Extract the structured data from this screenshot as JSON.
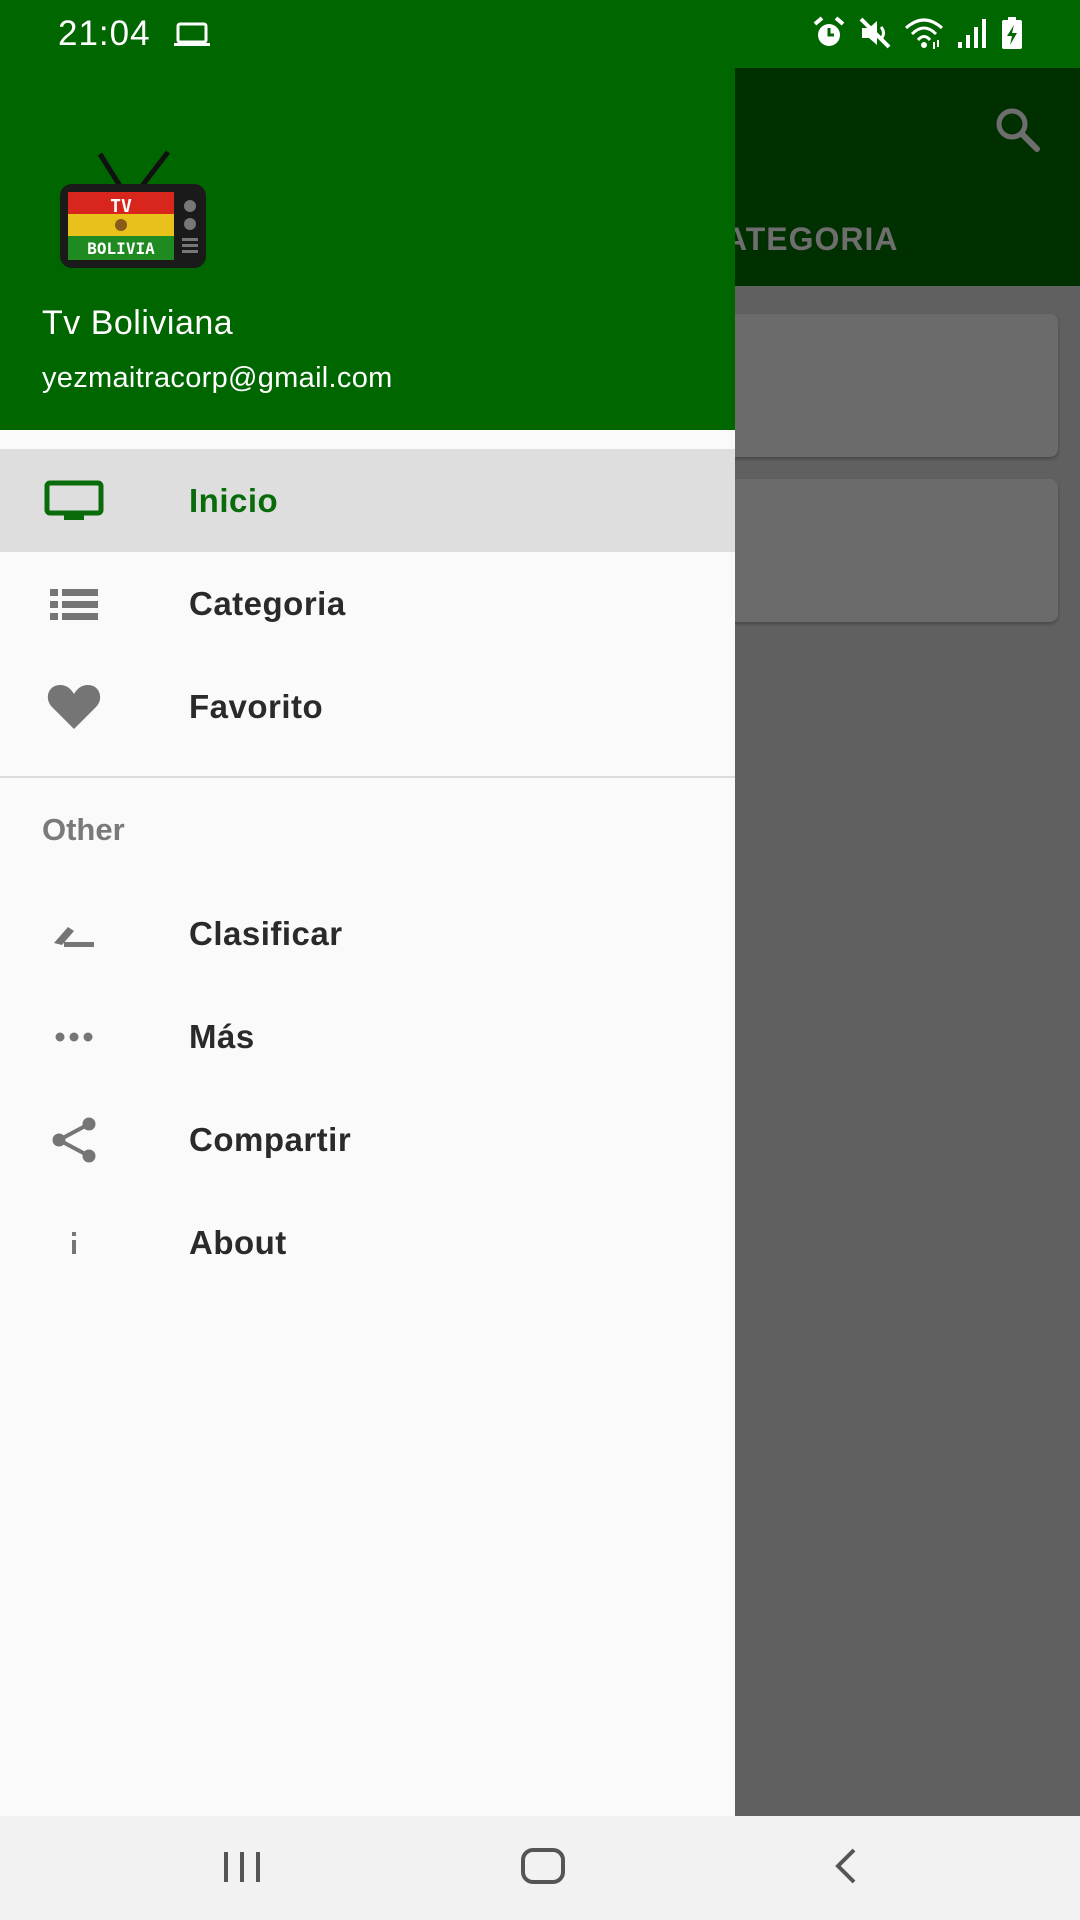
{
  "status_bar": {
    "time": "21:04",
    "left_icons": [
      "laptop-icon"
    ],
    "right_icons": [
      "alarm-icon",
      "mute-icon",
      "wifi-icon",
      "signal-icon",
      "battery-charging-icon"
    ]
  },
  "app": {
    "search_icon": "search-icon",
    "tab_label": "ATEGORIA"
  },
  "drawer": {
    "header": {
      "title": "Tv Boliviana",
      "email": "yezmaitracorp@gmail.com",
      "logo_text": [
        "TV",
        "BOLIVIA"
      ]
    },
    "items": [
      {
        "label": "Inicio",
        "icon": "tv-icon",
        "selected": true
      },
      {
        "label": "Categoria",
        "icon": "list-icon",
        "selected": false
      },
      {
        "label": "Favorito",
        "icon": "heart-icon",
        "selected": false
      }
    ],
    "section_other": "Other",
    "other_items": [
      {
        "label": "Clasificar",
        "icon": "rate-icon"
      },
      {
        "label": "Más",
        "icon": "more-icon"
      },
      {
        "label": "Compartir",
        "icon": "share-icon"
      },
      {
        "label": "About",
        "icon": "info-icon"
      }
    ]
  },
  "nav_bar": {
    "buttons": [
      "recents-icon",
      "home-icon",
      "back-icon"
    ]
  },
  "colors": {
    "primary": "#006600",
    "primary_dark_dimmed": "#003000",
    "selected_text": "#0a6b0a",
    "drawer_bg": "#fafafa",
    "selected_bg": "#dedede",
    "scrim": "#606060"
  }
}
